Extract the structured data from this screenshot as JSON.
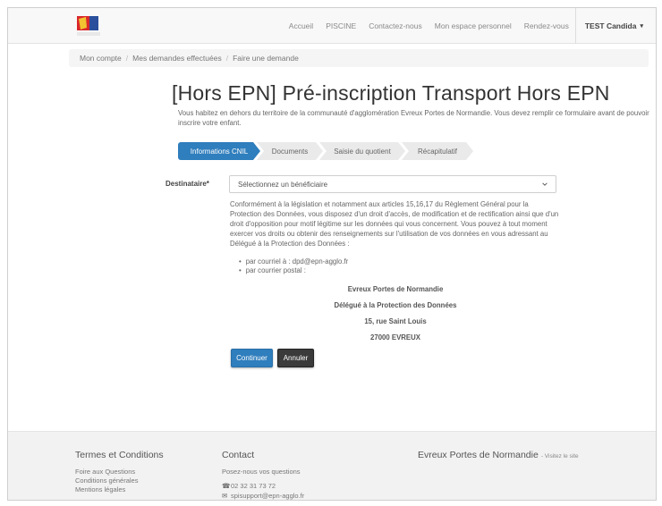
{
  "navbar": {
    "links": [
      "Accueil",
      "PISCINE",
      "Contactez-nous",
      "Mon espace personnel",
      "Rendez-vous"
    ],
    "user": "TEST Candida"
  },
  "breadcrumb": [
    "Mon compte",
    "Mes demandes effectuées",
    "Faire une demande"
  ],
  "page": {
    "title": "[Hors EPN] Pré-inscription Transport Hors EPN",
    "intro": "Vous habitez en dehors du territoire de la communauté d'agglomération Evreux Portes de Normandie. Vous devez remplir ce formulaire avant de pouvoir inscrire votre enfant."
  },
  "steps": [
    "Informations CNIL",
    "Documents",
    "Saisie du quotient",
    "Récapitulatif"
  ],
  "form": {
    "destinataire_label": "Destinataire*",
    "destinataire_value": "Sélectionnez un bénéficiaire",
    "cnil_text": "Conformément à la législation et notamment aux articles 15,16,17 du Règlement Général pour la Protection des Données, vous disposez d'un droit d'accès, de modification et de rectification ainsi que d'un droit d'opposition pour motif légitime sur les données qui vous concernent. Vous pouvez à tout moment exercer vos droits ou obtenir des renseignements sur l'utilisation de vos données en vous adressant au Délégué à la Protection des Données :",
    "bullets": [
      "par courriel à : dpd@epn-agglo.fr",
      "par courrier postal :"
    ],
    "address": [
      "Evreux Portes de Normandie",
      "Délégué à la Protection des Données",
      "15, rue Saint Louis",
      "27000 EVREUX"
    ],
    "continue_label": "Continuer",
    "cancel_label": "Annuler"
  },
  "footer": {
    "terms_title": "Termes et Conditions",
    "terms_links": [
      "Foire aux Questions",
      "Conditions générales",
      "Mentions légales"
    ],
    "contact_title": "Contact",
    "contact_lines": [
      "Posez-nous vos questions",
      "02 32 31 73 72",
      "spisupport@epn-agglo.fr"
    ],
    "brand": "Evreux Portes de Normandie",
    "visit": "- Visitez le site"
  },
  "colors": {
    "primary": "#2f7ebd",
    "dark": "#3a3a3a"
  }
}
